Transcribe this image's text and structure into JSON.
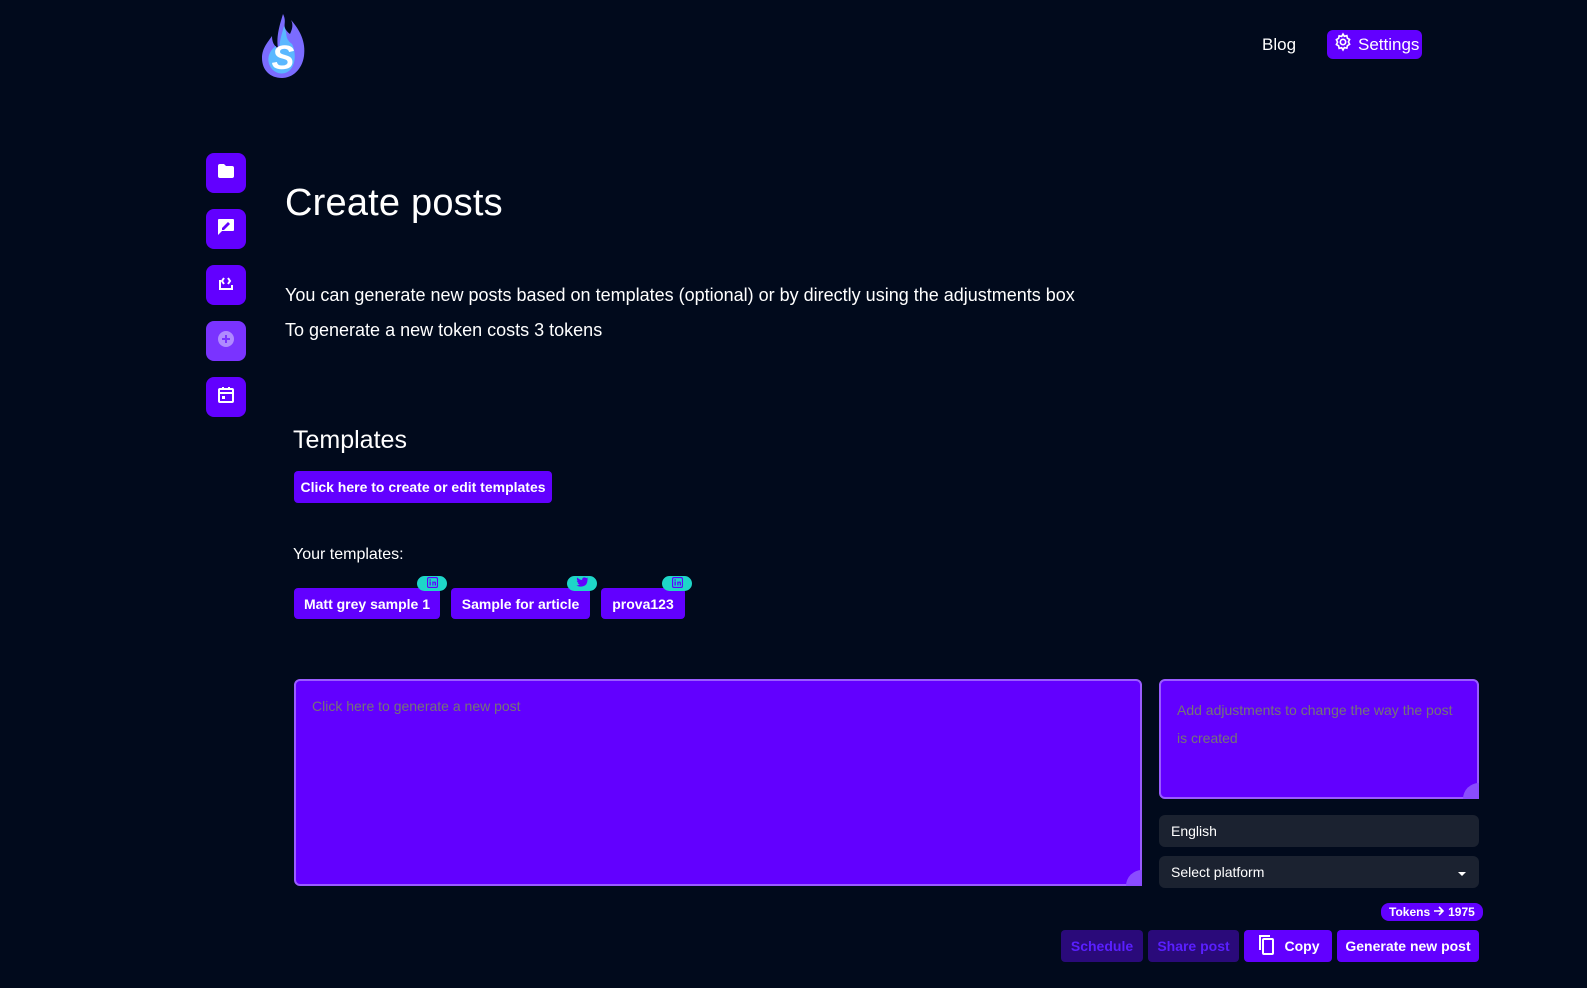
{
  "header": {
    "logo_letter": "S",
    "blog_label": "Blog",
    "settings_label": "Settings"
  },
  "sidebar": {
    "items": [
      {
        "icon": "folder-icon"
      },
      {
        "icon": "chat-edit-icon"
      },
      {
        "icon": "code-box-icon"
      },
      {
        "icon": "plus-circle-icon"
      },
      {
        "icon": "calendar-icon"
      }
    ]
  },
  "main": {
    "title": "Create posts",
    "description_1": "You can generate new posts based on templates (optional) or by directly using the adjustments box",
    "description_2": "To generate a new token costs 3 tokens"
  },
  "templates": {
    "heading": "Templates",
    "edit_button_label": "Click here to create or edit templates",
    "your_templates_label": "Your templates:",
    "items": [
      {
        "label": "Matt grey sample 1",
        "platform": "linkedin"
      },
      {
        "label": "Sample for article",
        "platform": "twitter"
      },
      {
        "label": "prova123",
        "platform": "linkedin"
      }
    ]
  },
  "editor": {
    "post_placeholder": "Click here to generate a new post",
    "adjustments_placeholder": "Add adjustments to change the way the post is created",
    "language_value": "English",
    "platform_placeholder": "Select platform"
  },
  "footer": {
    "tokens_label": "Tokens",
    "tokens_value": "1975",
    "schedule_label": "Schedule",
    "share_label": "Share post",
    "copy_label": "Copy",
    "generate_label": "Generate new post"
  },
  "colors": {
    "background": "#010a1c",
    "accent": "#6200ff",
    "badge": "#1ed6c8",
    "select_bg": "#1b2230"
  }
}
